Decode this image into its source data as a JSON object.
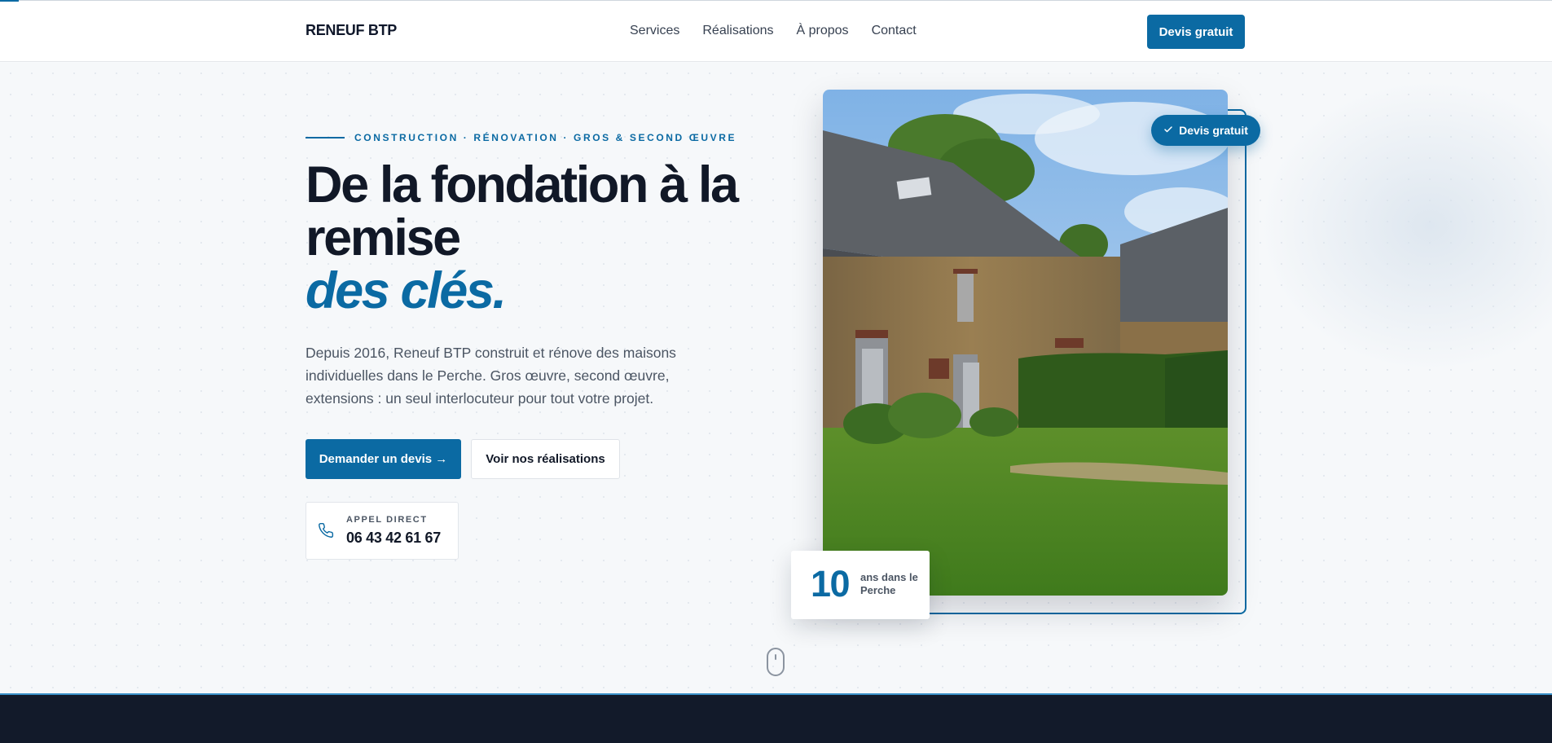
{
  "header": {
    "logo": "RENEUF BTP",
    "nav": [
      "Services",
      "Réalisations",
      "À propos",
      "Contact"
    ],
    "cta_label": "Devis gratuit"
  },
  "hero": {
    "eyebrow": "CONSTRUCTION · RÉNOVATION · GROS & SECOND ŒUVRE",
    "title_line1": "De la fondation à la remise",
    "title_accent": "des clés.",
    "description": "Depuis 2016, Reneuf BTP construit et rénove des maisons individuelles dans le Perche. Gros œuvre, second œuvre, extensions : un seul interlocuteur pour tout votre projet.",
    "primary_cta": "Demander un devis →",
    "secondary_cta": "Voir nos réalisations",
    "phone": {
      "label": "APPEL DIRECT",
      "number": "06 43 42 61 67"
    }
  },
  "image_card": {
    "badge": "Devis gratuit",
    "years_value": "10",
    "years_text": "ans dans le Perche"
  },
  "colors": {
    "brand": "#0b6aa3",
    "dark": "#111827",
    "footer": "#121a2a"
  },
  "icons": [
    "phone-icon",
    "check-icon",
    "mouse-scroll-icon"
  ]
}
